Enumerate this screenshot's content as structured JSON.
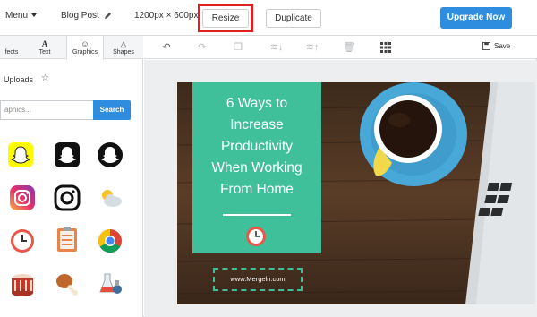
{
  "topbar": {
    "menu_label": "Menu",
    "doc_type": "Blog Post",
    "dimensions": "1200px × 600px",
    "resize_label": "Resize",
    "duplicate_label": "Duplicate",
    "upgrade_label": "Upgrade Now"
  },
  "left_panel": {
    "tabs": [
      {
        "label": "fects",
        "icon": "effects-icon"
      },
      {
        "label": "Text",
        "icon": "text-icon"
      },
      {
        "label": "Graphics",
        "icon": "smiley-icon"
      },
      {
        "label": "Shapes",
        "icon": "triangle-icon"
      }
    ],
    "uploads_label": "Uploads",
    "search": {
      "placeholder": "aphics...",
      "button_label": "Search"
    },
    "graphics": [
      "snapchat-yellow-icon",
      "snapchat-black-rounded-icon",
      "snapchat-black-circle-icon",
      "instagram-color-icon",
      "instagram-black-icon",
      "weather-partly-sunny-icon",
      "clock-icon",
      "clipboard-icon",
      "chrome-icon",
      "cake-icon",
      "chicken-leg-icon",
      "lab-flask-icon"
    ]
  },
  "toolbar": {
    "save_label": "Save",
    "tools": [
      "undo-icon",
      "redo-icon",
      "copy-icon",
      "layer-down-icon",
      "layer-up-icon",
      "trash-icon",
      "grid-icon"
    ]
  },
  "design": {
    "headline_lines": [
      "6 Ways to",
      "Increase",
      "Productivity",
      "When Working",
      "From Home"
    ],
    "url_text": "www.Mergeln.com"
  },
  "colors": {
    "accent_blue": "#2e8ddf",
    "highlight_red": "#e02020",
    "card_teal": "#3fbf9a",
    "wood": "#4a3221",
    "cup_blue": "#48a9d8"
  }
}
